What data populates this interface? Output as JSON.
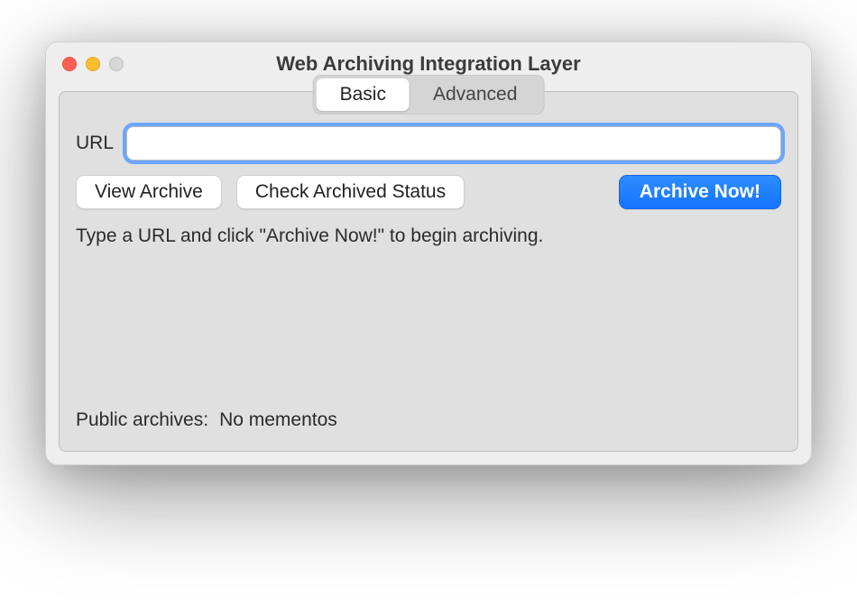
{
  "window": {
    "title": "Web Archiving Integration Layer"
  },
  "tabs": {
    "basic": "Basic",
    "advanced": "Advanced",
    "active": "basic"
  },
  "form": {
    "url_label": "URL",
    "url_value": "",
    "view_archive_label": "View Archive",
    "check_status_label": "Check Archived Status",
    "archive_now_label": "Archive Now!"
  },
  "hint_text": "Type a URL and click \"Archive Now!\" to begin archiving.",
  "status": {
    "public_archives_label": "Public archives:",
    "public_archives_value": "No mementos"
  },
  "colors": {
    "primary_blue": "#1e7fff",
    "focus_ring": "#6aa6ff"
  }
}
